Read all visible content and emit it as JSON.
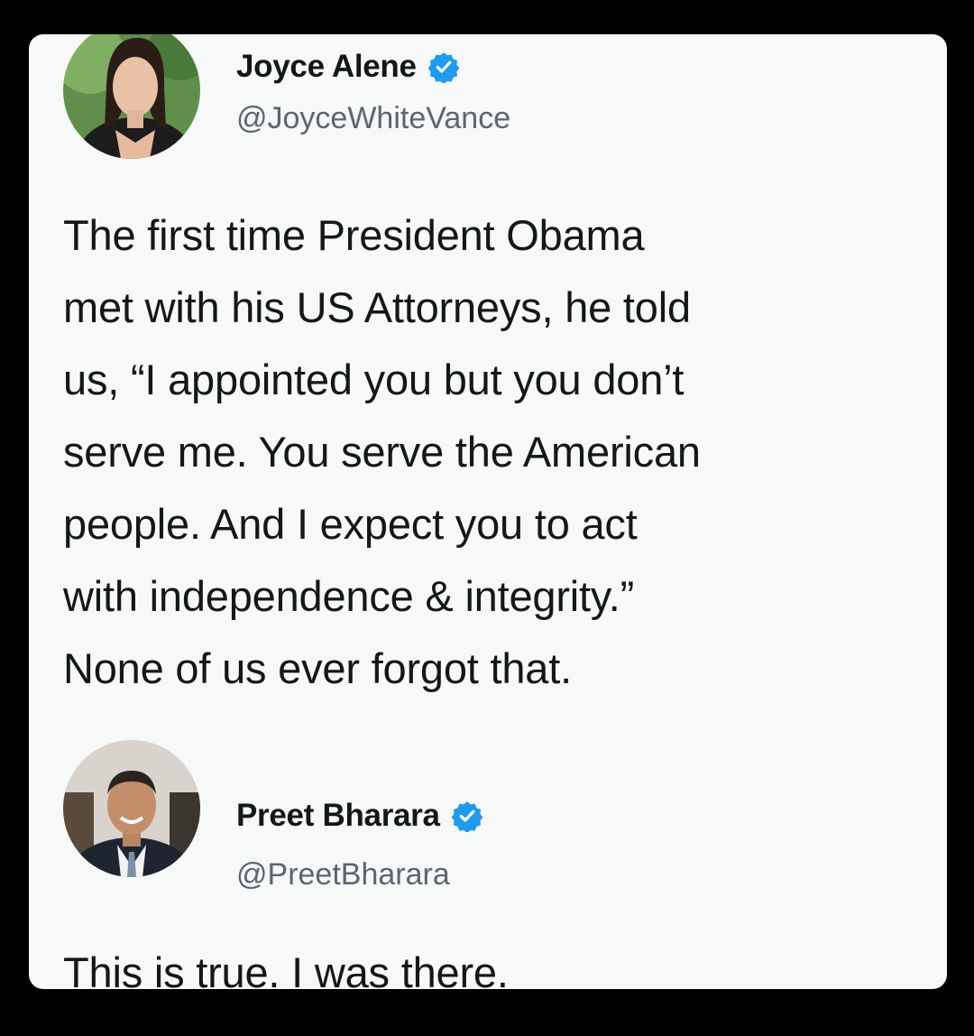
{
  "tweets": [
    {
      "display_name": "Joyce Alene",
      "handle": "@JoyceWhiteVance",
      "verified": true,
      "avatar": "woman-portrait-avatar",
      "body_lines": [
        "The first time President Obama",
        "met with his US Attorneys, he told",
        "us, “I appointed you but you don’t",
        "serve me. You serve the American",
        "people. And I expect you to act",
        "with independence & integrity.”",
        "None of us ever forgot that."
      ]
    },
    {
      "display_name": "Preet Bharara",
      "handle": "@PreetBharara",
      "verified": true,
      "avatar": "man-portrait-avatar",
      "body_lines": [
        "This is true. I was there."
      ]
    }
  ],
  "colors": {
    "background": "#000000",
    "card": "#f7f8f8",
    "verified_badge": "#1d9bf0",
    "text": "#14171a",
    "handle": "#5b6670"
  }
}
